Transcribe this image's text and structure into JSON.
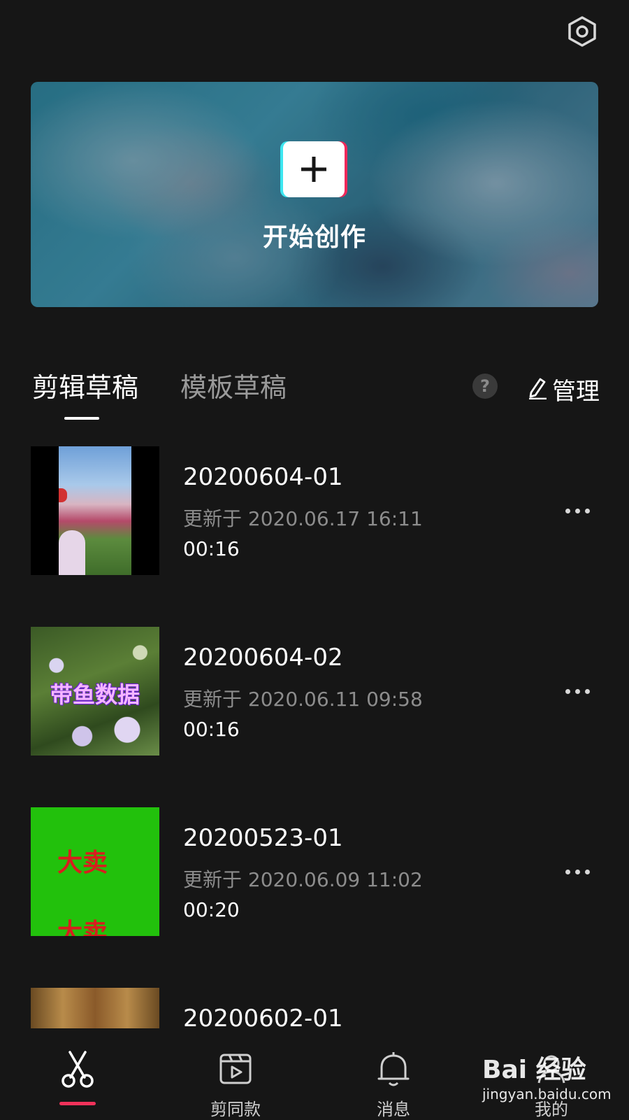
{
  "header": {
    "settings_icon": "settings-hexagon-icon"
  },
  "banner": {
    "create_label": "开始创作",
    "plus_icon": "plus-icon"
  },
  "tabs": [
    {
      "label": "剪辑草稿",
      "active": true
    },
    {
      "label": "模板草稿",
      "active": false
    }
  ],
  "toolbar": {
    "help_label": "?",
    "manage_label": "管理"
  },
  "drafts": [
    {
      "title": "20200604-01",
      "updated": "更新于 2020.06.17 16:11",
      "duration": "00:16"
    },
    {
      "title": "20200604-02",
      "updated": "更新于 2020.06.11 09:58",
      "duration": "00:16",
      "thumb_text": "带鱼数据"
    },
    {
      "title": "20200523-01",
      "updated": "更新于 2020.06.09 11:02",
      "duration": "00:20",
      "thumb_text": "大卖",
      "thumb_text_2": "大卖"
    },
    {
      "title": "20200602-01"
    }
  ],
  "bottom_nav": [
    {
      "label": "",
      "icon": "scissors-icon",
      "active": true
    },
    {
      "label": "剪同款",
      "icon": "clapperboard-play-icon",
      "active": false
    },
    {
      "label": "消息",
      "icon": "bell-icon",
      "active": false
    },
    {
      "label": "我的",
      "icon": "profile-icon",
      "active": false
    }
  ],
  "watermark": {
    "logo": "Bai 经验",
    "url": "jingyan.baidu.com"
  },
  "colors": {
    "background": "#161616",
    "accent": "#f0325a",
    "muted_text": "#8c8c8c"
  }
}
